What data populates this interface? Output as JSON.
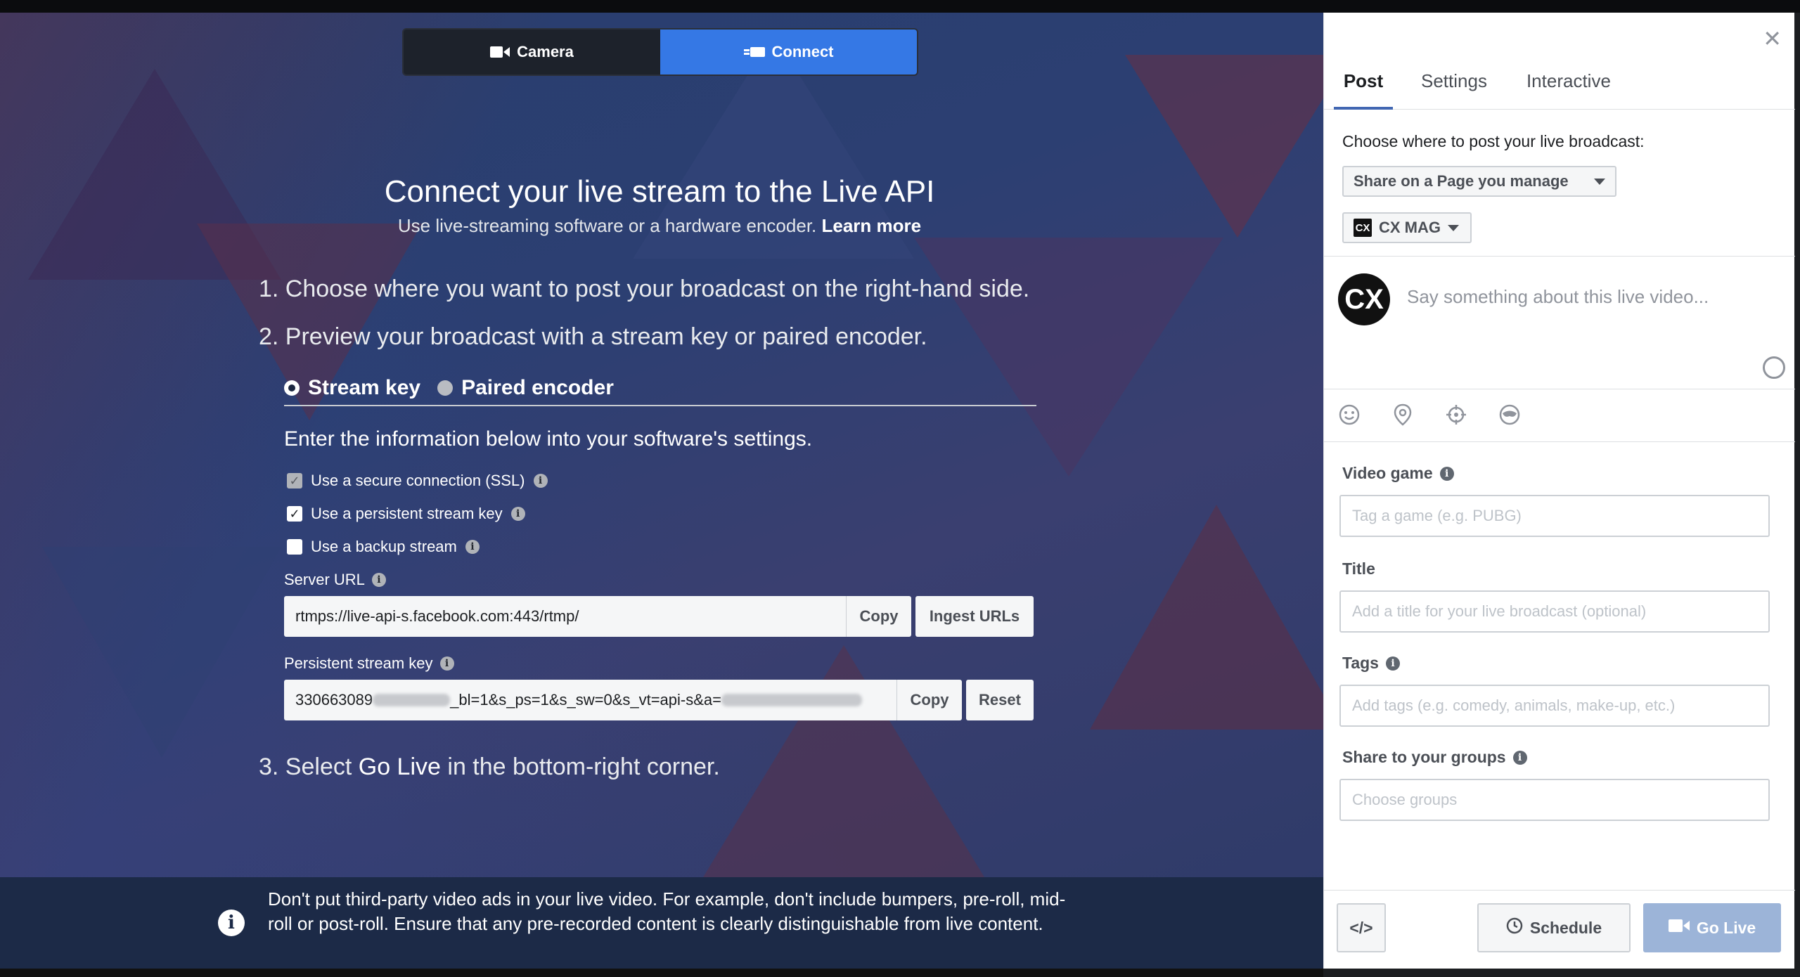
{
  "mode": {
    "camera_label": "Camera",
    "connect_label": "Connect"
  },
  "main": {
    "heading": "Connect your live stream to the Live API",
    "subheading": "Use live-streaming software or a hardware encoder.",
    "learn_more": "Learn more",
    "step1": "1. Choose where you want to post your broadcast on the right-hand side.",
    "step2": "2. Preview your broadcast with a stream key or paired encoder.",
    "step3_prefix": "3. Select ",
    "step3_highlight": "Go Live",
    "step3_suffix": " in the bottom-right corner.",
    "radio_stream_key": "Stream key",
    "radio_paired_encoder": "Paired encoder",
    "enter_info": "Enter the information below into your software's settings.",
    "checks": [
      {
        "label": "Use a secure connection (SSL)",
        "checked": true,
        "disabled": true
      },
      {
        "label": "Use a persistent stream key",
        "checked": true,
        "disabled": false
      },
      {
        "label": "Use a backup stream",
        "checked": false,
        "disabled": false
      }
    ],
    "server_url_label": "Server URL",
    "server_url_value": "rtmps://live-api-s.facebook.com:443/rtmp/",
    "copy_label": "Copy",
    "ingest_urls_label": "Ingest URLs",
    "stream_key_label": "Persistent stream key",
    "stream_key_visible_start": "330663089",
    "stream_key_visible_mid": "_bl=1&s_ps=1&s_sw=0&s_vt=api-s&a=",
    "reset_label": "Reset",
    "notice": "Don't put third-party video ads in your live video. For example, don't include bumpers, pre-roll, mid-roll or post-roll. Ensure that any pre-recorded content is clearly distinguishable from live content."
  },
  "panel": {
    "tabs": [
      "Post",
      "Settings",
      "Interactive"
    ],
    "choose_where": "Choose where to post your live broadcast:",
    "share_dropdown": "Share on a Page you manage",
    "page_dropdown": "CX MAG",
    "page_logo": "CX",
    "compose_placeholder": "Say something about this live video...",
    "tools": [
      "emoji-icon",
      "location-pin-icon",
      "target-icon",
      "mask-icon"
    ],
    "video_game_label": "Video game",
    "video_game_placeholder": "Tag a game (e.g. PUBG)",
    "title_label": "Title",
    "title_placeholder": "Add a title for your live broadcast (optional)",
    "tags_label": "Tags",
    "tags_placeholder": "Add tags (e.g. comedy, animals, make-up, etc.)",
    "groups_label": "Share to your groups",
    "groups_placeholder": "Choose groups",
    "embed_label": "</>",
    "schedule_label": "Schedule",
    "go_live_label": "Go Live"
  }
}
